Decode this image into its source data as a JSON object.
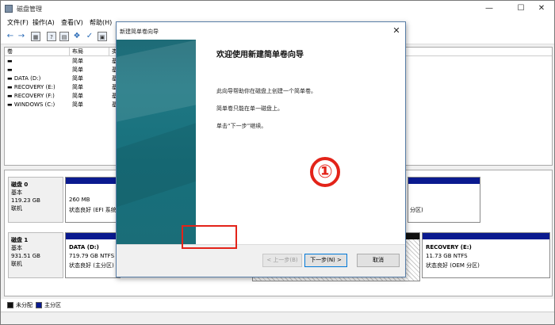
{
  "window": {
    "title": "磁盘管理",
    "controls": [
      "—",
      "☐",
      "✕"
    ]
  },
  "menu": [
    "文件(F)",
    "操作(A)",
    "查看(V)",
    "帮助(H)"
  ],
  "volume_list": {
    "headers": [
      "卷",
      "布局",
      "类"
    ],
    "rows": [
      {
        "name": "▬",
        "layout": "简单",
        "type": "基"
      },
      {
        "name": "▬",
        "layout": "简单",
        "type": "基"
      },
      {
        "name": "▬ DATA (D:)",
        "layout": "简单",
        "type": "基"
      },
      {
        "name": "▬ RECOVERY (E:)",
        "layout": "简单",
        "type": "基"
      },
      {
        "name": "▬ RECOVERY (F:)",
        "layout": "简单",
        "type": "基"
      },
      {
        "name": "▬ WINDOWS (C:)",
        "layout": "简单",
        "type": "基"
      }
    ]
  },
  "disks": [
    {
      "label": "磁盘 0",
      "kind": "基本",
      "size": "119.23 GB",
      "status": "联机",
      "partitions": [
        {
          "size": "260 MB",
          "status": "状态良好 (EFI 系统"
        },
        {
          "status": "分区)"
        }
      ]
    },
    {
      "label": "磁盘 1",
      "kind": "基本",
      "size": "931.51 GB",
      "status": "联机",
      "partitions": [
        {
          "name": "DATA  (D:)",
          "size": "719.79 GB NTFS",
          "status": "状态良好 (主分区)"
        },
        {
          "name": "RECOVERY  (E:)",
          "size": "11.73 GB NTFS",
          "status": "状态良好 (OEM 分区)"
        }
      ]
    }
  ],
  "legend": [
    {
      "label": "未分配",
      "color": "#111111"
    },
    {
      "label": "主分区",
      "color": "#0a1a8f"
    }
  ],
  "wizard": {
    "title": "新建简单卷向导",
    "heading": "欢迎使用新建简单卷向导",
    "paragraphs": [
      "此向导帮助你在磁盘上创建一个简单卷。",
      "简单卷只能在单一磁盘上。",
      "单击“下一步”继续。"
    ],
    "buttons": {
      "back": "< 上一步(B)",
      "next": "下一步(N) >",
      "cancel": "取消"
    },
    "step_marker": "①"
  }
}
